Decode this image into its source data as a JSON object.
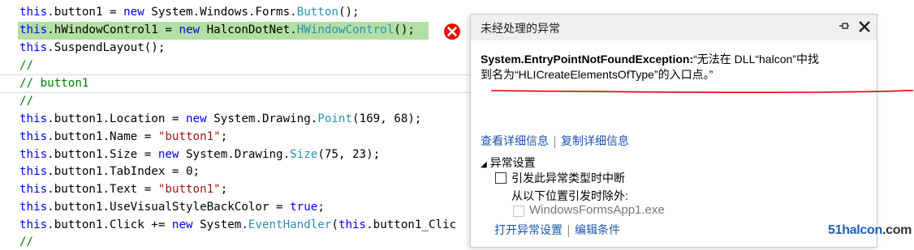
{
  "code_lines": [
    {
      "tokens": [
        {
          "t": "this",
          "c": "kw"
        },
        {
          "t": ".button1 = ",
          "c": ""
        },
        {
          "t": "new",
          "c": "kw"
        },
        {
          "t": " System.Windows.Forms.",
          "c": ""
        },
        {
          "t": "Button",
          "c": "ty"
        },
        {
          "t": "();",
          "c": ""
        }
      ]
    },
    {
      "tokens": [
        {
          "t": "this",
          "c": "kw"
        },
        {
          "t": ".hWindowControl1 = ",
          "c": ""
        },
        {
          "t": "new",
          "c": "kw"
        },
        {
          "t": " HalconDotNet.",
          "c": ""
        },
        {
          "t": "HWindowControl",
          "c": "ty"
        },
        {
          "t": "();",
          "c": ""
        }
      ]
    },
    {
      "tokens": [
        {
          "t": "this",
          "c": "kw"
        },
        {
          "t": ".SuspendLayout();",
          "c": ""
        }
      ]
    },
    {
      "tokens": [
        {
          "t": "//",
          "c": "cm"
        }
      ]
    },
    {
      "tokens": [
        {
          "t": "// button1",
          "c": "cm"
        }
      ]
    },
    {
      "tokens": [
        {
          "t": "//",
          "c": "cm"
        }
      ]
    },
    {
      "tokens": [
        {
          "t": "this",
          "c": "kw"
        },
        {
          "t": ".button1.Location = ",
          "c": ""
        },
        {
          "t": "new",
          "c": "kw"
        },
        {
          "t": " System.Drawing.",
          "c": ""
        },
        {
          "t": "Point",
          "c": "ty"
        },
        {
          "t": "(169, 68);",
          "c": ""
        }
      ]
    },
    {
      "tokens": [
        {
          "t": "this",
          "c": "kw"
        },
        {
          "t": ".button1.Name = ",
          "c": ""
        },
        {
          "t": "\"button1\"",
          "c": "st"
        },
        {
          "t": ";",
          "c": ""
        }
      ]
    },
    {
      "tokens": [
        {
          "t": "this",
          "c": "kw"
        },
        {
          "t": ".button1.Size = ",
          "c": ""
        },
        {
          "t": "new",
          "c": "kw"
        },
        {
          "t": " System.Drawing.",
          "c": ""
        },
        {
          "t": "Size",
          "c": "ty"
        },
        {
          "t": "(75, 23);",
          "c": ""
        }
      ]
    },
    {
      "tokens": [
        {
          "t": "this",
          "c": "kw"
        },
        {
          "t": ".button1.TabIndex = 0;",
          "c": ""
        }
      ]
    },
    {
      "tokens": [
        {
          "t": "this",
          "c": "kw"
        },
        {
          "t": ".button1.Text = ",
          "c": ""
        },
        {
          "t": "\"button1\"",
          "c": "st"
        },
        {
          "t": ";",
          "c": ""
        }
      ]
    },
    {
      "tokens": [
        {
          "t": "this",
          "c": "kw"
        },
        {
          "t": ".button1.UseVisualStyleBackColor = ",
          "c": ""
        },
        {
          "t": "true",
          "c": "kw"
        },
        {
          "t": ";",
          "c": ""
        }
      ]
    },
    {
      "tokens": [
        {
          "t": "this",
          "c": "kw"
        },
        {
          "t": ".button1.Click += ",
          "c": ""
        },
        {
          "t": "new",
          "c": "kw"
        },
        {
          "t": " System.",
          "c": ""
        },
        {
          "t": "EventHandler",
          "c": "ty"
        },
        {
          "t": "(",
          "c": ""
        },
        {
          "t": "this",
          "c": "kw"
        },
        {
          "t": ".button1_Clic",
          "c": ""
        }
      ]
    },
    {
      "tokens": [
        {
          "t": "//",
          "c": "cm"
        }
      ]
    }
  ],
  "exception_panel": {
    "title": "未经处理的异常",
    "pin_icon": "pin-icon",
    "close_icon": "close-icon",
    "exception_type": "System.EntryPointNotFoundException:",
    "message_line1": "“无法在 DLL“halcon”中找",
    "message_line2": "到名为“HLICreateElementsOfType”的入口点。”",
    "view_details": "查看详细信息",
    "copy_details": "复制详细信息",
    "settings_header": "异常设置",
    "break_on_type": "引发此异常类型时中断",
    "except_when_from": "从以下位置引发时除外:",
    "module_name": "WindowsFormsApp1.exe",
    "open_settings": "打开异常设置",
    "edit_conditions": "编辑条件"
  },
  "watermark": {
    "brand": "51halcon",
    "domain": ".com"
  },
  "colors": {
    "keyword": "#0000ff",
    "type": "#2b91af",
    "string": "#a31515",
    "comment": "#008000",
    "highlight": "#b4dfa4",
    "error": "#e51400",
    "link": "#1a56a8",
    "annotation": "#e00000"
  }
}
